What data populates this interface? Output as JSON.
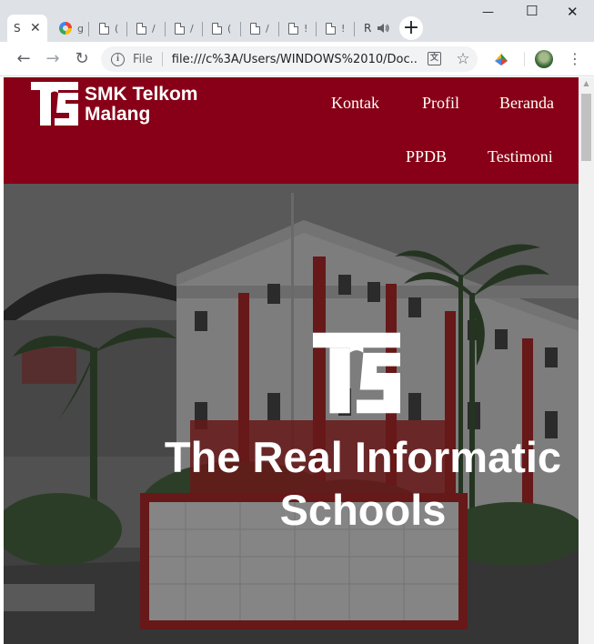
{
  "browser": {
    "tabs": [
      {
        "title": "S",
        "active": true,
        "icon": "none"
      },
      {
        "title": "g",
        "icon": "google-icon"
      },
      {
        "title": "(",
        "icon": "document-icon"
      },
      {
        "title": "/",
        "icon": "document-icon"
      },
      {
        "title": "/",
        "icon": "document-icon"
      },
      {
        "title": "(",
        "icon": "document-icon"
      },
      {
        "title": "/",
        "icon": "document-icon"
      },
      {
        "title": "!",
        "icon": "document-icon"
      },
      {
        "title": "!",
        "icon": "document-icon"
      },
      {
        "title": "R",
        "icon": "none",
        "audio": true
      }
    ],
    "close_tab": "✕",
    "new_tab": "+",
    "window_controls": {
      "minimize": "—",
      "maximize": "☐",
      "close": "✕"
    },
    "toolbar": {
      "back": "←",
      "forward": "→",
      "reload": "↻",
      "info": "i",
      "file_label": "File",
      "url": "file:///c%3A/Users/WINDOWS%2010/Doc...",
      "translate": "文",
      "star": "☆",
      "menu": "⋮"
    }
  },
  "site": {
    "brand_line1": "SMK Telkom",
    "brand_line2": "Malang",
    "nav": {
      "kontak": "Kontak",
      "profil": "Profil",
      "beranda": "Beranda",
      "ppdb": "PPDB",
      "testimoni": "Testimoni"
    },
    "hero": {
      "title_line1": "The Real Informatic",
      "title_line2": "Schools"
    },
    "colors": {
      "navbar": "#870017",
      "hero_text": "#ffffff"
    }
  }
}
